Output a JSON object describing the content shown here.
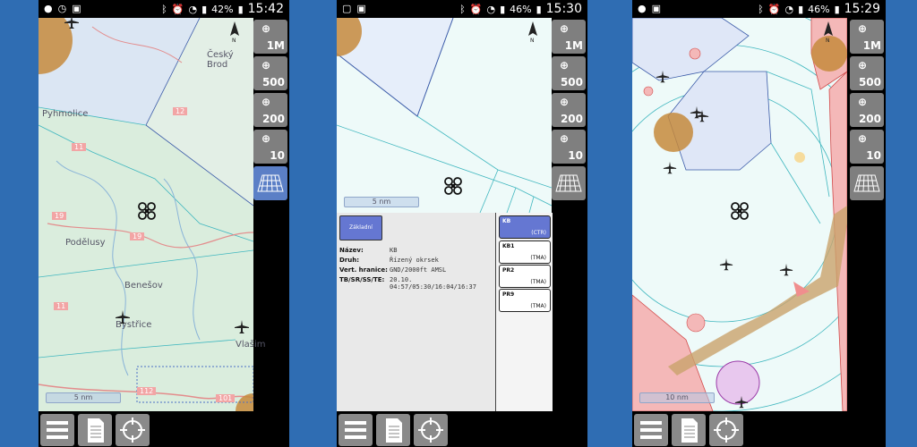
{
  "screens": [
    {
      "status": {
        "battery": "42%",
        "time": "15:42"
      },
      "map_labels": [
        "Český Brod",
        "Pyhmolice",
        "Podělusy",
        "Benešov",
        "Bystřice",
        "Vlašim",
        "11",
        "12",
        "19",
        "19",
        "11",
        "112",
        "101"
      ],
      "scale": "5 nm"
    },
    {
      "status": {
        "battery": "46%",
        "time": "15:30"
      },
      "scale": "5 nm",
      "info": {
        "button": "Základní",
        "rows": [
          {
            "label": "Název:",
            "value": "KB"
          },
          {
            "label": "Druh:",
            "value": "Řízený okrsek"
          },
          {
            "label": "Vert. hranice:",
            "value": "GND/2000ft AMSL"
          },
          {
            "label": "TB/SR/SS/TE:",
            "value": "20.10. 04:57/05:30/16:04/16:37"
          }
        ],
        "zones": [
          {
            "name": "KB",
            "type": "(CTR)"
          },
          {
            "name": "KB1",
            "type": "(TMA)"
          },
          {
            "name": "PR2",
            "type": "(TMA)"
          },
          {
            "name": "PR9",
            "type": "(TMA)"
          }
        ]
      }
    },
    {
      "status": {
        "battery": "46%",
        "time": "15:29"
      },
      "scale": "10 nm"
    }
  ],
  "zoom_buttons": [
    "1M",
    "500",
    "200",
    "10"
  ],
  "icons": {
    "north": "north-arrow-icon",
    "drone": "drone-icon",
    "plane": "airplane-icon",
    "menu": "menu-icon",
    "doc": "document-icon",
    "target": "crosshair-icon",
    "grid": "grid-icon"
  }
}
